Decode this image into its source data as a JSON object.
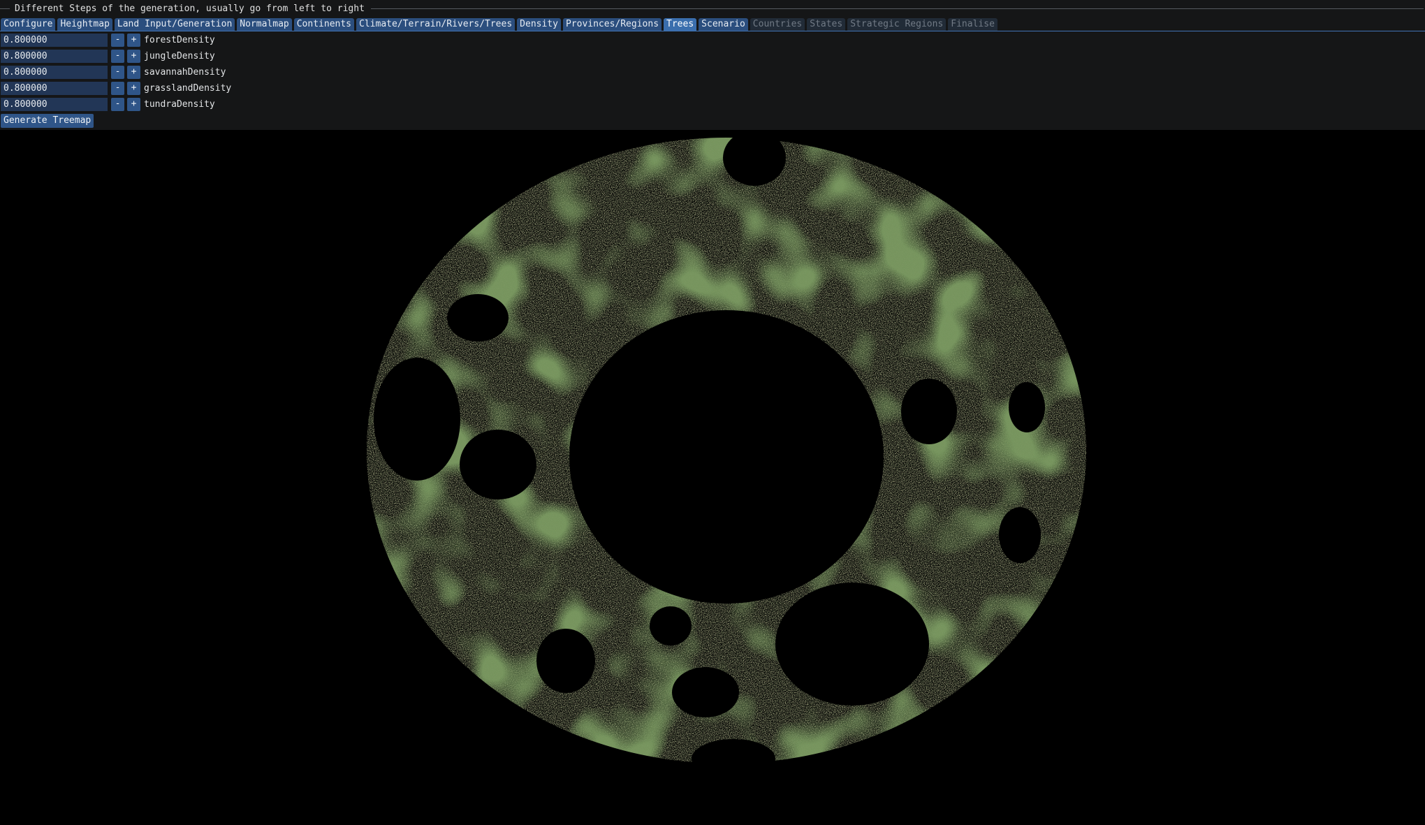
{
  "header": {
    "title": "Different Steps of the generation, usually go from left to right"
  },
  "tabs": [
    {
      "label": "Configure",
      "state": "normal"
    },
    {
      "label": "Heightmap",
      "state": "normal"
    },
    {
      "label": "Land Input/Generation",
      "state": "normal"
    },
    {
      "label": "Normalmap",
      "state": "normal"
    },
    {
      "label": "Continents",
      "state": "normal"
    },
    {
      "label": "Climate/Terrain/Rivers/Trees",
      "state": "normal"
    },
    {
      "label": "Density",
      "state": "normal"
    },
    {
      "label": "Provinces/Regions",
      "state": "normal"
    },
    {
      "label": "Trees",
      "state": "active"
    },
    {
      "label": "Scenario",
      "state": "normal"
    },
    {
      "label": "Countries",
      "state": "dim"
    },
    {
      "label": "States",
      "state": "dim"
    },
    {
      "label": "Strategic Regions",
      "state": "dim"
    },
    {
      "label": "Finalise",
      "state": "dim"
    }
  ],
  "density_fields": [
    {
      "value": "0.800000",
      "label": "forestDensity"
    },
    {
      "value": "0.800000",
      "label": "jungleDensity"
    },
    {
      "value": "0.800000",
      "label": "savannahDensity"
    },
    {
      "value": "0.800000",
      "label": "grasslandDensity"
    },
    {
      "value": "0.800000",
      "label": "tundraDensity"
    }
  ],
  "controls": {
    "minus": "-",
    "plus": "+",
    "generate_label": "Generate Treemap"
  },
  "viewport": {
    "colors": {
      "background": "#000000",
      "tree_olive": "#5f5a36",
      "tree_tan": "#7b6f49",
      "tree_green": "#2e4a1c",
      "tree_dark_green": "#223a16"
    }
  }
}
